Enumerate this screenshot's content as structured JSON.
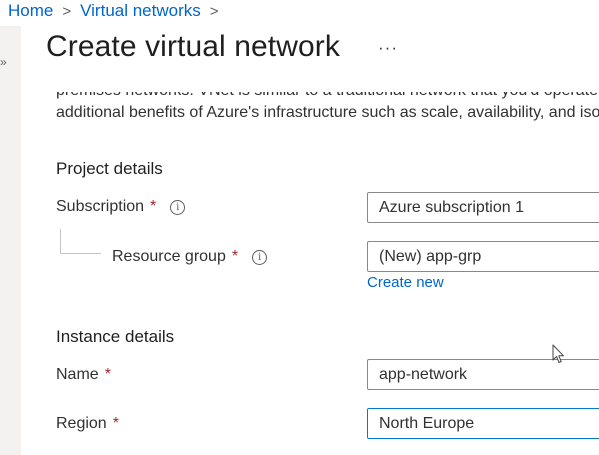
{
  "breadcrumb": {
    "home": "Home",
    "parent": "Virtual networks"
  },
  "page": {
    "title": "Create virtual network",
    "more_label": "···",
    "description_line1": "premises networks. VNet is similar to a traditional network that you'd operate in your own data center, but brings with it",
    "description_line2": "additional benefits of Azure's infrastructure such as scale, availability, and isolation."
  },
  "project_details": {
    "heading": "Project details",
    "subscription_label": "Subscription",
    "subscription_value": "Azure subscription 1",
    "resource_group_label": "Resource group",
    "resource_group_value": "(New) app-grp",
    "create_new_label": "Create new"
  },
  "instance_details": {
    "heading": "Instance details",
    "name_label": "Name",
    "name_value": "app-network",
    "region_label": "Region",
    "region_value": "North Europe"
  },
  "required_mark": "*",
  "info_glyph": "i",
  "icons": [
    "chevron-right-icon",
    "info-icon",
    "more-icon",
    "mouse-cursor-icon"
  ],
  "colors": {
    "link": "#0066cc",
    "required": "#a4262c",
    "focus_border": "#0078d4",
    "field_border": "#8a8886"
  }
}
